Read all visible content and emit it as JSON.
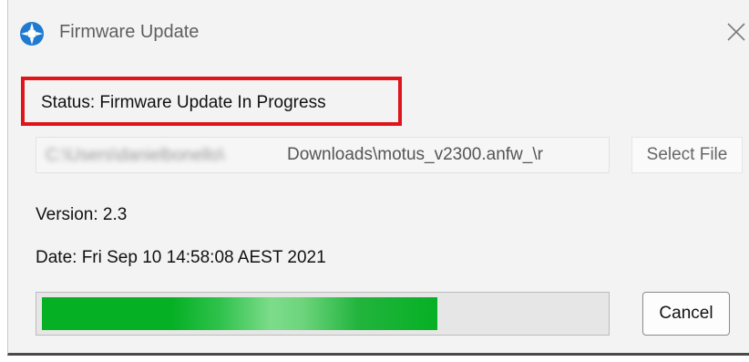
{
  "window": {
    "title": "Firmware Update",
    "app_icon": "app-logo-icon",
    "close_icon": "close-icon"
  },
  "status": {
    "text": "Status: Firmware Update In Progress",
    "highlight_color": "#e0151b"
  },
  "file": {
    "path_obscured": "C:\\Users\\danielbonello\\",
    "path_visible": "Downloads\\motus_v2300.anfw_\\r",
    "select_label": "Select File"
  },
  "info": {
    "version": "Version: 2.3",
    "date": "Date: Fri Sep 10 14:58:08 AEST 2021"
  },
  "progress": {
    "fraction": 0.705,
    "color": "#06b025"
  },
  "actions": {
    "cancel_label": "Cancel"
  }
}
